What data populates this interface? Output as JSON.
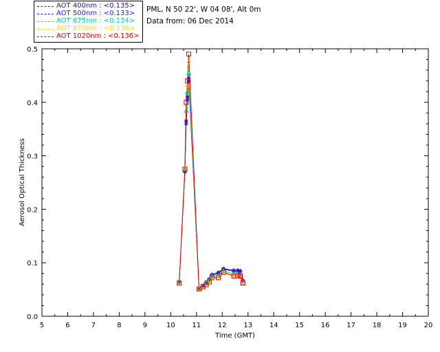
{
  "header": {
    "location": "PML, N 50 22', W 04 08', Alt 0m",
    "date_line": "Data from: 06 Dec 2014"
  },
  "legend": [
    {
      "label": "AOT  400nm : <0.135>",
      "color": "#3a0a8a"
    },
    {
      "label": "AOT  500nm : <0.133>",
      "color": "#1a1aff"
    },
    {
      "label": "AOT  675nm : <0.134>",
      "color": "#00d0a0"
    },
    {
      "label": "AOT  870nm : <0.136>",
      "color": "#ffd800"
    },
    {
      "label": "AOT 1020nm : <0.136>",
      "color": "#e00000"
    }
  ],
  "chart_data": {
    "type": "line",
    "title": "",
    "xlabel": "Time (GMT)",
    "ylabel": "Aerosol Optical Thickness",
    "xlim": [
      5,
      20
    ],
    "ylim": [
      0.0,
      0.5
    ],
    "xticks": [
      "5",
      "6",
      "7",
      "8",
      "9",
      "10",
      "11",
      "12",
      "13",
      "14",
      "15",
      "16",
      "17",
      "18",
      "19",
      "20"
    ],
    "yticks": [
      "0.0",
      "0.1",
      "0.2",
      "0.3",
      "0.4",
      "0.5"
    ],
    "series": [
      {
        "name": "AOT  400nm",
        "color": "#3a0a8a",
        "marker": "star",
        "x": [
          10.33,
          10.55,
          10.6,
          10.65,
          10.7,
          11.1,
          11.25,
          11.38,
          11.5,
          11.6,
          11.85,
          12.05,
          12.45,
          12.6,
          12.7,
          12.8
        ],
        "y": [
          0.065,
          0.27,
          0.365,
          0.41,
          0.44,
          0.052,
          0.058,
          0.064,
          0.07,
          0.078,
          0.082,
          0.089,
          0.086,
          0.086,
          0.085,
          0.067
        ]
      },
      {
        "name": "AOT  500nm",
        "color": "#1a1aff",
        "marker": "star",
        "x": [
          10.33,
          10.55,
          10.6,
          10.65,
          10.7,
          11.1,
          11.25,
          11.38,
          11.5,
          11.6,
          11.85,
          12.05,
          12.45,
          12.6,
          12.7,
          12.8
        ],
        "y": [
          0.064,
          0.27,
          0.36,
          0.405,
          0.445,
          0.052,
          0.057,
          0.063,
          0.069,
          0.077,
          0.08,
          0.088,
          0.084,
          0.084,
          0.083,
          0.066
        ]
      },
      {
        "name": "AOT  675nm",
        "color": "#00d0a0",
        "marker": "triangle",
        "x": [
          10.33,
          10.55,
          10.6,
          10.65,
          10.7,
          11.1,
          11.25,
          11.38,
          11.5,
          11.6,
          11.85,
          12.05,
          12.45,
          12.6,
          12.7,
          12.8
        ],
        "y": [
          0.064,
          0.275,
          0.385,
          0.42,
          0.455,
          0.052,
          0.057,
          0.062,
          0.068,
          0.075,
          0.076,
          0.085,
          0.079,
          0.079,
          0.078,
          0.064
        ]
      },
      {
        "name": "AOT  870nm",
        "color": "#ffd800",
        "marker": "diamond",
        "x": [
          10.33,
          10.55,
          10.6,
          10.65,
          10.7,
          11.1,
          11.25,
          11.38,
          11.5,
          11.6,
          11.85,
          12.05,
          12.45,
          12.6,
          12.7,
          12.8
        ],
        "y": [
          0.063,
          0.275,
          0.395,
          0.43,
          0.475,
          0.051,
          0.056,
          0.06,
          0.065,
          0.073,
          0.073,
          0.083,
          0.076,
          0.077,
          0.076,
          0.063
        ]
      },
      {
        "name": "AOT 1020nm",
        "color": "#e00000",
        "marker": "square",
        "x": [
          10.33,
          10.55,
          10.6,
          10.65,
          10.7,
          11.1,
          11.25,
          11.38,
          11.5,
          11.6,
          11.85,
          12.05,
          12.45,
          12.6,
          12.7,
          12.8
        ],
        "y": [
          0.062,
          0.275,
          0.4,
          0.44,
          0.49,
          0.051,
          0.055,
          0.059,
          0.064,
          0.072,
          0.072,
          0.082,
          0.075,
          0.076,
          0.075,
          0.062
        ]
      }
    ],
    "grid": false,
    "legend_position": "top-left"
  }
}
